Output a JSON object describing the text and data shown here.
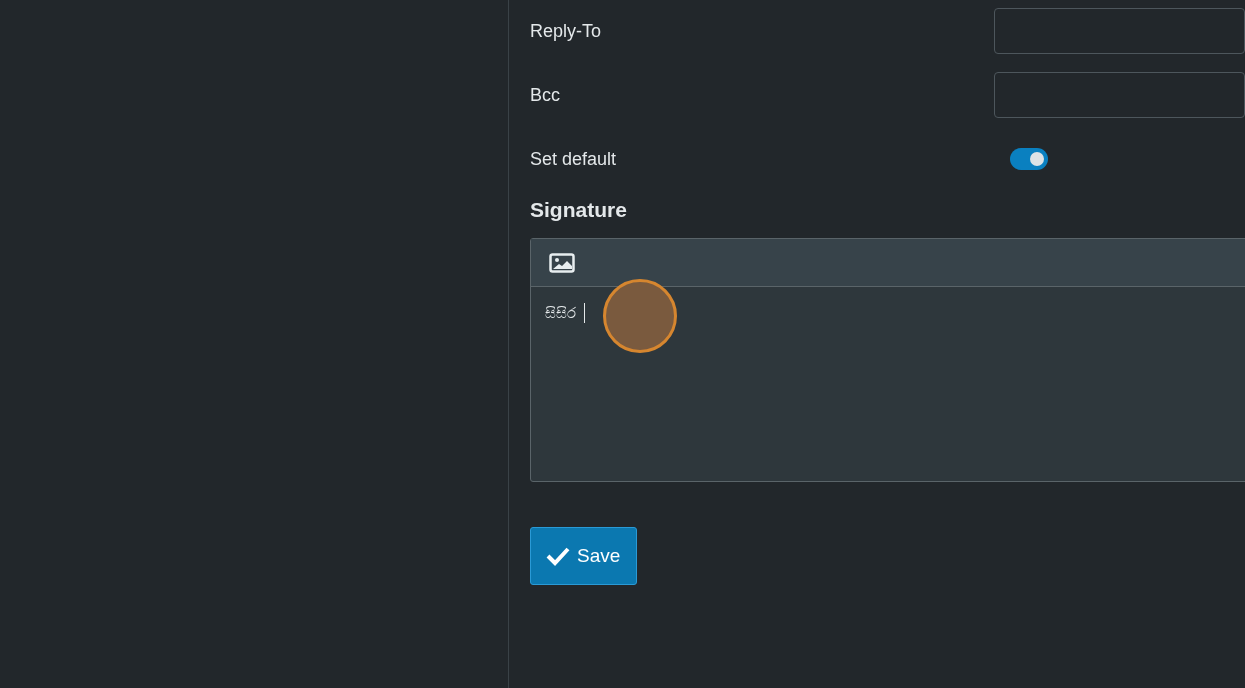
{
  "fields": [
    {
      "kind": "text",
      "label": "Reply-To"
    },
    {
      "kind": "text",
      "label": "Bcc"
    },
    {
      "kind": "toggle",
      "label": "Set default",
      "on": true
    }
  ],
  "signature": {
    "heading": "Signature",
    "text": "සිසිර"
  },
  "save_button": {
    "label": "Save"
  }
}
